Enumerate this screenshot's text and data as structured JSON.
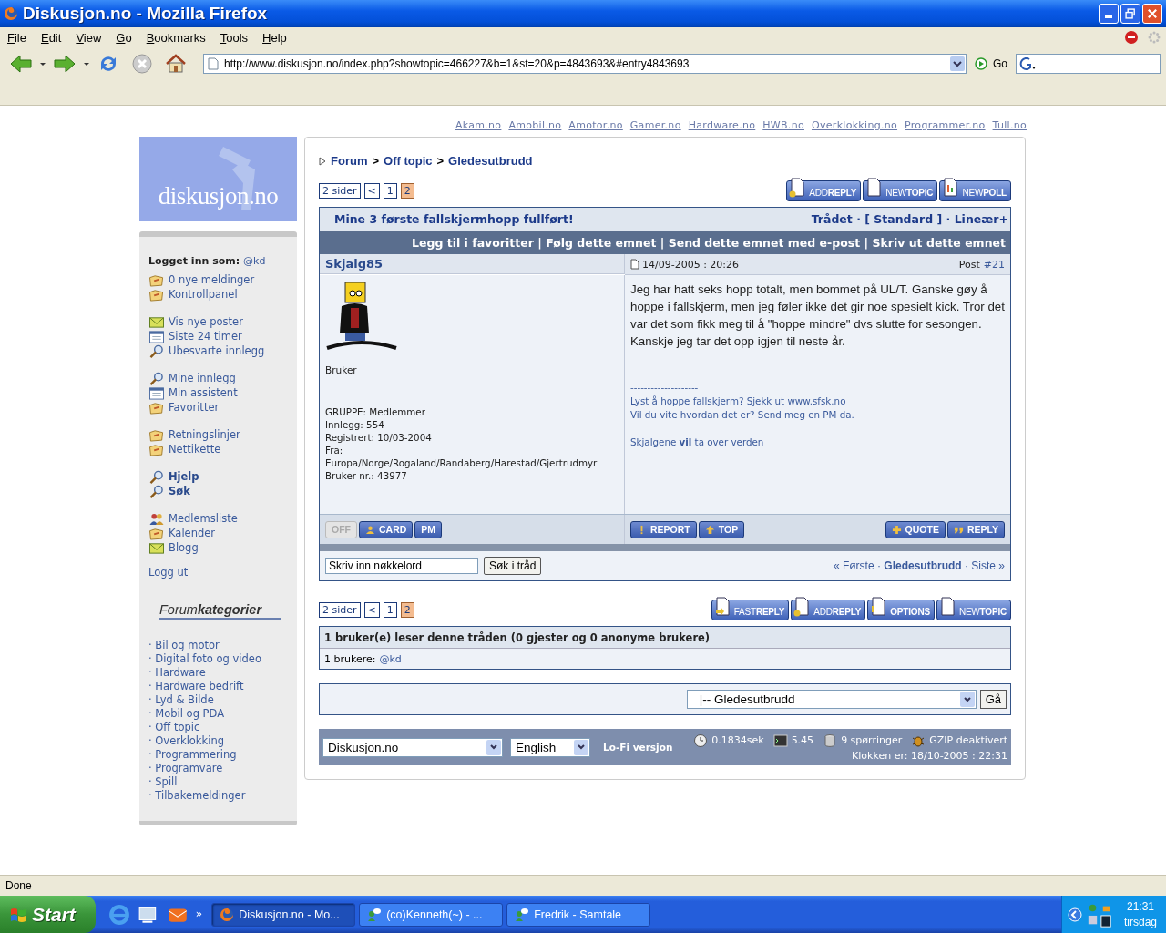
{
  "window": {
    "title": "Diskusjon.no - Mozilla Firefox"
  },
  "menu": [
    "File",
    "Edit",
    "View",
    "Go",
    "Bookmarks",
    "Tools",
    "Help"
  ],
  "toolbar": {
    "url": "http://www.diskusjon.no/index.php?showtopic=466227&b=1&st=20&p=4843693&#entry4843693",
    "go": "Go"
  },
  "site_links": [
    "Akam.no",
    "Amobil.no",
    "Amotor.no",
    "Gamer.no",
    "Hardware.no",
    "HWB.no",
    "Overklokking.no",
    "Programmer.no",
    "Tull.no"
  ],
  "sidebar": {
    "logo": "diskusjon.no",
    "logged_in_label": "Logget inn som:",
    "logged_in_user": "@kd",
    "groups": [
      [
        {
          "label": "0 nye meldinger",
          "kind": "folder",
          "bold": false
        },
        {
          "label": "Kontrollpanel",
          "kind": "folder",
          "bold": false
        }
      ],
      [
        {
          "label": "Vis nye poster",
          "kind": "mail",
          "bold": false
        },
        {
          "label": "Siste 24 timer",
          "kind": "calendar",
          "bold": false
        },
        {
          "label": "Ubesvarte innlegg",
          "kind": "search",
          "bold": false
        }
      ],
      [
        {
          "label": "Mine innlegg",
          "kind": "search",
          "bold": false
        },
        {
          "label": "Min assistent",
          "kind": "calendar",
          "bold": false
        },
        {
          "label": "Favoritter",
          "kind": "folder",
          "bold": false
        }
      ],
      [
        {
          "label": "Retningslinjer",
          "kind": "folder",
          "bold": false
        },
        {
          "label": "Nettikette",
          "kind": "folder",
          "bold": false
        }
      ],
      [
        {
          "label": "Hjelp",
          "kind": "search",
          "bold": true
        },
        {
          "label": "Søk",
          "kind": "search",
          "bold": true
        }
      ],
      [
        {
          "label": "Medlemsliste",
          "kind": "people",
          "bold": false
        },
        {
          "label": "Kalender",
          "kind": "folder",
          "bold": false
        },
        {
          "label": "Blogg",
          "kind": "mail",
          "bold": false
        }
      ]
    ],
    "logout": "Logg ut",
    "categories_title": "Forum**kategorier**",
    "categories": [
      "· Bil og motor",
      "· Digital foto og video",
      "· Hardware",
      "· Hardware bedrift",
      "· Lyd & Bilde",
      "· Mobil og PDA",
      "· Off topic",
      "· Overklokking",
      "· Programmering",
      "· Programvare",
      "· Spill",
      "· Tilbakemeldinger"
    ]
  },
  "breadcrumb": [
    {
      "label": "Forum",
      "kind": "link"
    },
    {
      "label": ">",
      "kind": "sep"
    },
    {
      "label": "Off topic",
      "kind": "link"
    },
    {
      "label": ">",
      "kind": "sep"
    },
    {
      "label": "Gledesutbrudd",
      "kind": "link"
    }
  ],
  "pagination_top": {
    "label": "2 sider",
    "prev": "<",
    "pages": [
      {
        "label": "1",
        "selected": false
      },
      {
        "label": "2",
        "selected": true
      }
    ]
  },
  "buttons_top": [
    {
      "label": "ADD**REPLY**",
      "kind": "add"
    },
    {
      "label": "NEW**TOPIC**",
      "kind": "page"
    },
    {
      "label": "NEW**POLL**",
      "kind": "poll"
    }
  ],
  "topic": {
    "title": "Mine 3 første fallskjermhopp fullført!",
    "modes": "Trådet · [ Standard ] · Lineær+",
    "actions": "Legg til i favoritter | Følg dette emnet | Send dette emnet med e-post | Skriv ut dette emnet"
  },
  "post": {
    "author": "Skjalg85",
    "date": "14/09-2005 : 20:26",
    "post_label": "Post",
    "post_number": "#21",
    "rank": "Bruker",
    "details": [
      "GRUPPE: Medlemmer",
      "Innlegg: 554",
      "Registrert: 10/03-2004",
      "Fra:",
      "Europa/Norge/Rogaland/Randaberg/Harestad/Gjertrudmyr",
      "Bruker nr.: 43977"
    ],
    "body": "Jeg har hatt seks hopp totalt, men bommet på UL/T. Ganske gøy å hoppe i fallskjerm, men jeg føler ikke det gir noe spesielt kick. Tror det var det som fikk meg til å \"hoppe mindre\" dvs slutte for sesongen. Kanskje jeg tar det opp igjen til neste år.",
    "signature": [
      "--------------------",
      "Lyst å hoppe fallskjerm? Sjekk ut www.sfsk.no",
      "Vil du vite hvordan det er? Send meg en PM da."
    ],
    "motto": "Skjalgene **vil** ta over verden",
    "user_buttons": [
      {
        "label": "OFF",
        "kind": "plain",
        "disabled": true
      },
      {
        "label": "CARD",
        "kind": "person",
        "disabled": false
      },
      {
        "label": "PM",
        "kind": "plain",
        "disabled": false
      }
    ],
    "mod_buttons": [
      {
        "label": "REPORT",
        "kind": "exclaim",
        "disabled": false
      },
      {
        "label": "TOP",
        "kind": "up",
        "disabled": false
      }
    ],
    "reply_buttons": [
      {
        "label": "QUOTE",
        "kind": "plus",
        "disabled": false
      },
      {
        "label": "REPLY",
        "kind": "quote",
        "disabled": false
      }
    ]
  },
  "thread_search": {
    "value": "Skriv inn nøkkelord",
    "button": "Søk i tråd",
    "nav": "« Første · **Gledesutbrudd** · Siste »"
  },
  "pagination_bottom": {
    "label": "2 sider",
    "prev": "<",
    "pages": [
      {
        "label": "1",
        "selected": false
      },
      {
        "label": "2",
        "selected": true
      }
    ]
  },
  "buttons_bottom": [
    {
      "label": "FAST**REPLY**",
      "kind": "fast"
    },
    {
      "label": "ADD**REPLY**",
      "kind": "add"
    },
    {
      "label": "**OPTIONS**",
      "kind": "options"
    },
    {
      "label": "NEW**TOPIC**",
      "kind": "page"
    }
  ],
  "readers": {
    "title": "1 bruker(e) leser denne tråden (0 gjester og 0 anonyme brukere)",
    "label": "1 brukere:",
    "user": "@kd"
  },
  "jump": {
    "select": "|-- Gledesutbrudd",
    "button": "Gå"
  },
  "footer": {
    "skin": "Diskusjon.no",
    "language": "English",
    "lofi": "Lo-Fi versjon",
    "stats": [
      {
        "kind": "clock",
        "text": "0.1834sek"
      },
      {
        "kind": "terminal",
        "text": "5.45"
      },
      {
        "kind": "database",
        "text": "9 spørringer"
      },
      {
        "kind": "bug",
        "text": "GZIP deaktivert"
      }
    ],
    "clock": "Klokken er: 18/10-2005 : 22:31"
  },
  "status_bar": "Done",
  "taskbar": {
    "start": "Start",
    "chevron": "»",
    "tasks": [
      {
        "label": "Diskusjon.no - Mo...",
        "kind": "firefox",
        "selected": true
      },
      {
        "label": "(co)Kenneth(~) - ...",
        "kind": "chat",
        "selected": false
      },
      {
        "label": "Fredrik - Samtale",
        "kind": "chat",
        "selected": false
      }
    ],
    "time": "21:31",
    "day": "tirsdag"
  }
}
